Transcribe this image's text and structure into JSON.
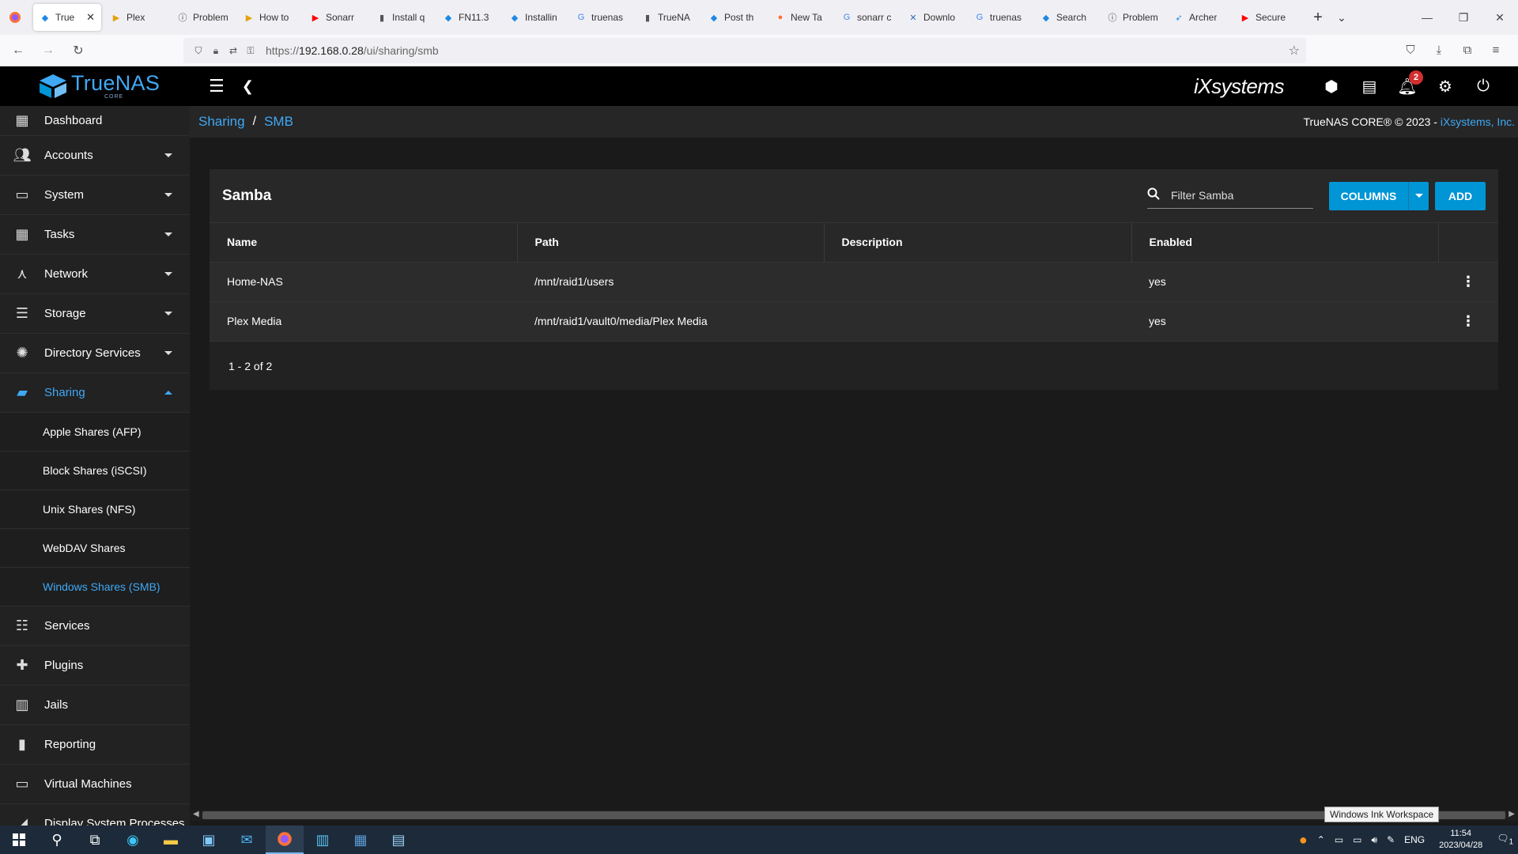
{
  "browser": {
    "tabs": [
      {
        "title": "True",
        "icon": "truenas-icon",
        "active": true
      },
      {
        "title": "Plex",
        "icon": "plex-icon"
      },
      {
        "title": "Problem",
        "icon": "info-icon"
      },
      {
        "title": "How to",
        "icon": "plex-icon"
      },
      {
        "title": "Sonarr",
        "icon": "youtube-icon"
      },
      {
        "title": "Install q",
        "icon": "page-icon"
      },
      {
        "title": "FN11.3",
        "icon": "truenas-icon"
      },
      {
        "title": "Installin",
        "icon": "truenas-icon"
      },
      {
        "title": "truenas",
        "icon": "google-icon"
      },
      {
        "title": "TrueNA",
        "icon": "page-icon"
      },
      {
        "title": "Post th",
        "icon": "truenas-icon"
      },
      {
        "title": "New Ta",
        "icon": "firefox-icon"
      },
      {
        "title": "sonarr c",
        "icon": "google-icon"
      },
      {
        "title": "Downlo",
        "icon": "x-icon"
      },
      {
        "title": "truenas",
        "icon": "google-icon"
      },
      {
        "title": "Search",
        "icon": "truenas-icon"
      },
      {
        "title": "Problem",
        "icon": "info-icon"
      },
      {
        "title": "Archer",
        "icon": "archer-icon"
      },
      {
        "title": "Secure",
        "icon": "youtube-icon"
      }
    ],
    "url_prefix": "https://",
    "url_host": "192.168.0.28",
    "url_path": "/ui/sharing/smb"
  },
  "topbar": {
    "logo_text": "TrueNAS",
    "logo_sub": "CORE",
    "brand": "iXsystems",
    "notification_count": "2"
  },
  "sidebar": {
    "items": [
      {
        "label": "Dashboard",
        "icon": "dashboard-icon"
      },
      {
        "label": "Accounts",
        "icon": "people-icon",
        "caret": "down"
      },
      {
        "label": "System",
        "icon": "laptop-icon",
        "caret": "down"
      },
      {
        "label": "Tasks",
        "icon": "calendar-icon",
        "caret": "down"
      },
      {
        "label": "Network",
        "icon": "network-icon",
        "caret": "down"
      },
      {
        "label": "Storage",
        "icon": "storage-icon",
        "caret": "down"
      },
      {
        "label": "Directory Services",
        "icon": "directory-icon",
        "caret": "down"
      },
      {
        "label": "Sharing",
        "icon": "folder-shared-icon",
        "caret": "up",
        "active": true
      }
    ],
    "sub_items": [
      {
        "label": "Apple Shares (AFP)"
      },
      {
        "label": "Block Shares (iSCSI)"
      },
      {
        "label": "Unix Shares (NFS)"
      },
      {
        "label": "WebDAV Shares"
      },
      {
        "label": "Windows Shares (SMB)",
        "active": true
      }
    ],
    "items_after": [
      {
        "label": "Services",
        "icon": "tune-icon"
      },
      {
        "label": "Plugins",
        "icon": "puzzle-icon"
      },
      {
        "label": "Jails",
        "icon": "jail-icon"
      },
      {
        "label": "Reporting",
        "icon": "chart-icon"
      },
      {
        "label": "Virtual Machines",
        "icon": "computer-icon"
      },
      {
        "label": "Display System Processes",
        "icon": "processes-icon"
      }
    ]
  },
  "breadcrumb": {
    "parent": "Sharing",
    "separator": "/",
    "current": "SMB"
  },
  "copyright": {
    "text": "TrueNAS CORE® © 2023 - ",
    "link": "iXsystems, Inc."
  },
  "card": {
    "title": "Samba",
    "filter_placeholder": "Filter Samba",
    "columns_label": "COLUMNS",
    "add_label": "ADD",
    "headers": [
      "Name",
      "Path",
      "Description",
      "Enabled"
    ],
    "rows": [
      {
        "name": "Home-NAS",
        "path": "/mnt/raid1/users",
        "description": "",
        "enabled": "yes"
      },
      {
        "name": "Plex Media",
        "path": "/mnt/raid1/vault0/media/Plex Media",
        "description": "",
        "enabled": "yes"
      }
    ],
    "pagination": "1 - 2 of 2"
  },
  "tooltip": "Windows Ink Workspace",
  "taskbar": {
    "lang": "ENG",
    "time": "11:54",
    "date": "2023/04/28",
    "notif_count": "1"
  },
  "colors": {
    "accent": "#3fa9f5",
    "button": "#0095d5",
    "badge": "#d32f2f"
  }
}
